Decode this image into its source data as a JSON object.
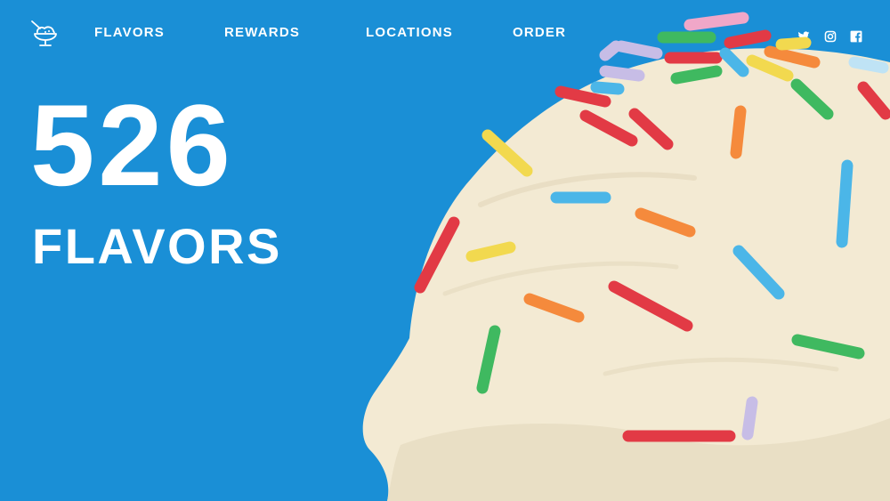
{
  "brand": {
    "logo_icon": "ice-cream-bowl-icon"
  },
  "nav": {
    "items": [
      {
        "label": "FLAVORS"
      },
      {
        "label": "REWARDS"
      },
      {
        "label": "LOCATIONS"
      },
      {
        "label": "ORDER"
      }
    ]
  },
  "social": {
    "icons": [
      "twitter-icon",
      "instagram-icon",
      "facebook-icon"
    ]
  },
  "hero": {
    "number": "526",
    "word": "FLAVORS"
  },
  "colors": {
    "background": "#1a8fd6",
    "text": "#ffffff",
    "ice_cream": "#f3ead3"
  }
}
